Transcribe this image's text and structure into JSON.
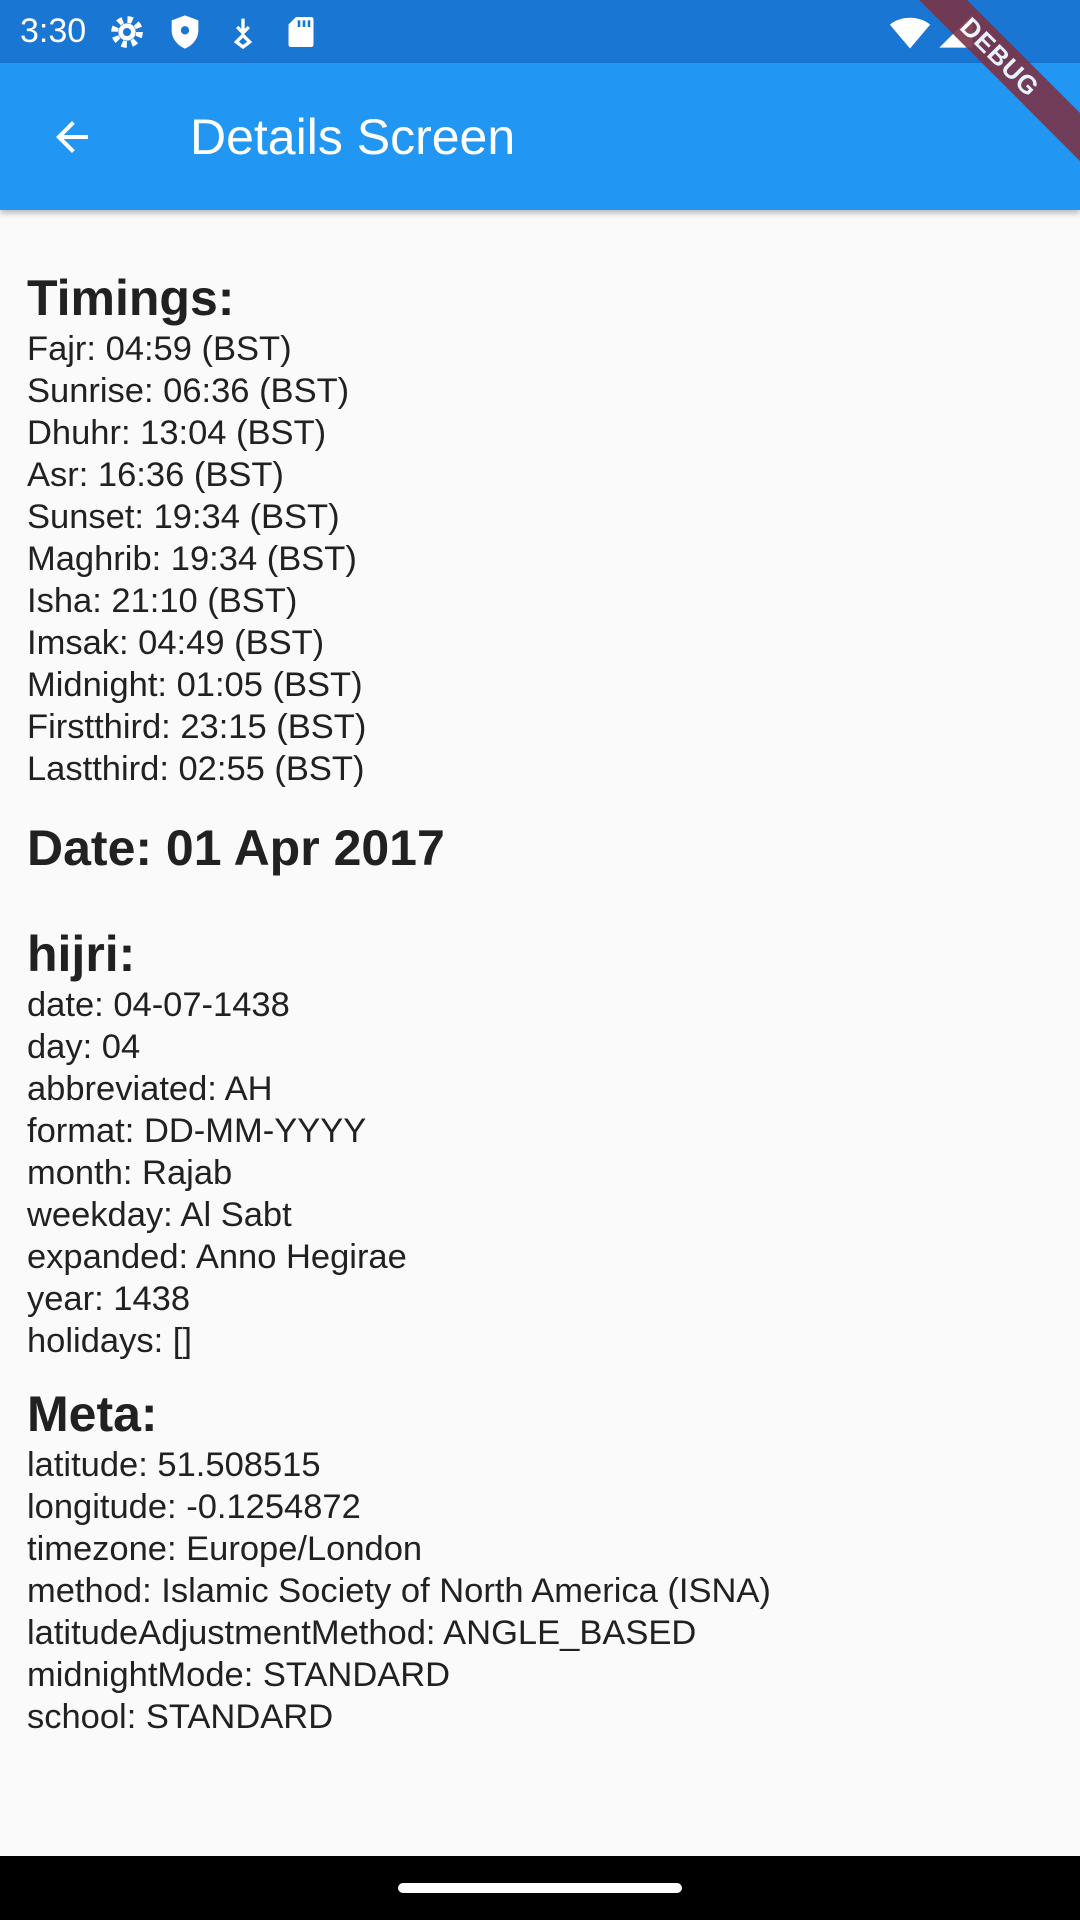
{
  "status_bar": {
    "time": "3:30",
    "icons": [
      "settings-icon",
      "shield-icon",
      "download-icon",
      "sd-card-icon",
      "wifi-icon",
      "signal-icon"
    ]
  },
  "app_bar": {
    "title": "Details Screen",
    "debug_banner": "DEBUG",
    "color": "#2196f3",
    "status_color": "#1976d2"
  },
  "timings": {
    "heading": "Timings:",
    "lines": [
      "Fajr: 04:59 (BST)",
      "Sunrise: 06:36 (BST)",
      "Dhuhr: 13:04 (BST)",
      "Asr: 16:36 (BST)",
      "Sunset: 19:34 (BST)",
      "Maghrib: 19:34 (BST)",
      "Isha: 21:10 (BST)",
      "Imsak: 04:49 (BST)",
      "Midnight: 01:05 (BST)",
      "Firstthird: 23:15 (BST)",
      "Lastthird: 02:55 (BST)"
    ]
  },
  "date": {
    "heading": "Date: 01 Apr 2017"
  },
  "hijri": {
    "heading": "hijri:",
    "lines": [
      "date: 04-07-1438",
      "day: 04",
      "abbreviated: AH",
      "format: DD-MM-YYYY",
      "month: Rajab",
      "weekday: Al Sabt",
      "expanded: Anno Hegirae",
      "year: 1438",
      "holidays: []"
    ]
  },
  "meta": {
    "heading": "Meta:",
    "lines": [
      "latitude: 51.508515",
      "longitude: -0.1254872",
      "timezone: Europe/London",
      "method: Islamic Society of North America (ISNA)",
      "latitudeAdjustmentMethod: ANGLE_BASED",
      "midnightMode: STANDARD",
      "school: STANDARD"
    ]
  }
}
